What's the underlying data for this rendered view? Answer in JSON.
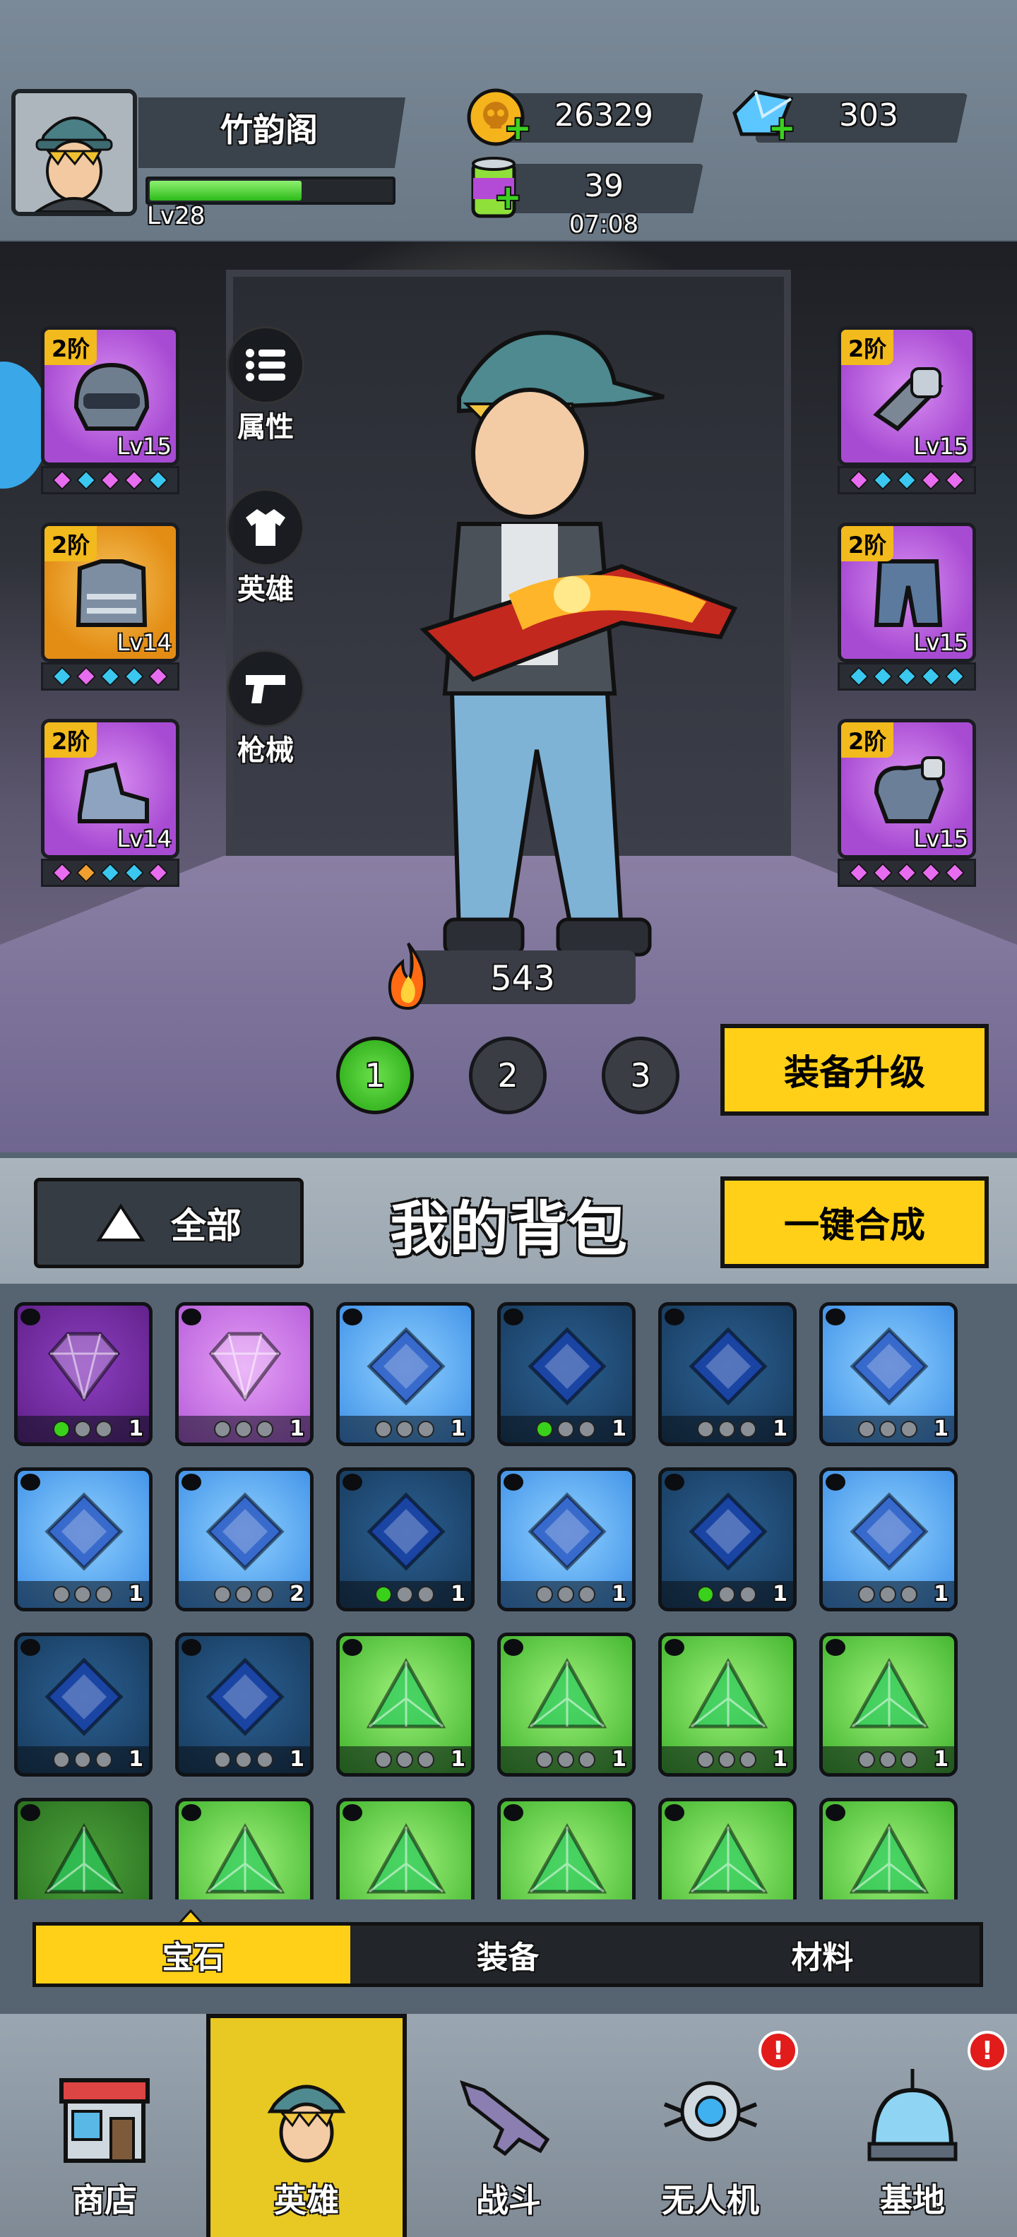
{
  "player": {
    "name": "竹韵阁",
    "level": "Lv28",
    "xp_fraction": 0.62
  },
  "resources": {
    "coins": "26329",
    "diamonds": "303",
    "energy": "39",
    "energy_timer": "07:08"
  },
  "equipment": {
    "left": [
      {
        "tier": "2阶",
        "level": "Lv15",
        "rarity": "purple",
        "icon": "helmet-icon"
      },
      {
        "tier": "2阶",
        "level": "Lv14",
        "rarity": "orange",
        "icon": "armor-icon"
      },
      {
        "tier": "2阶",
        "level": "Lv14",
        "rarity": "purple",
        "icon": "shoe-icon"
      }
    ],
    "right": [
      {
        "tier": "2阶",
        "level": "Lv15",
        "rarity": "purple",
        "icon": "bracer-icon"
      },
      {
        "tier": "2阶",
        "level": "Lv15",
        "rarity": "purple",
        "icon": "pants-icon"
      },
      {
        "tier": "2阶",
        "level": "Lv15",
        "rarity": "purple",
        "icon": "glove-icon"
      }
    ]
  },
  "side_menu": {
    "attributes": "属性",
    "hero": "英雄",
    "weapons": "枪械"
  },
  "combat_power": "543",
  "pages": [
    "1",
    "2",
    "3"
  ],
  "active_page": 0,
  "upgrade_button": "装备升级",
  "backpack": {
    "filter_label": "全部",
    "title": "我的背包",
    "merge_button": "一键合成",
    "tabs": [
      "宝石",
      "装备",
      "材料"
    ],
    "active_tab": 0,
    "items": [
      {
        "color": "purple-d",
        "shape": "diamond",
        "count": "1",
        "lit": 1
      },
      {
        "color": "purple-l",
        "shape": "diamond",
        "count": "1",
        "lit": 0
      },
      {
        "color": "blue-l",
        "shape": "square",
        "count": "1",
        "lit": 0
      },
      {
        "color": "blue-d",
        "shape": "square",
        "count": "1",
        "lit": 1
      },
      {
        "color": "blue-d",
        "shape": "square",
        "count": "1",
        "lit": 0
      },
      {
        "color": "blue-l",
        "shape": "square",
        "count": "1",
        "lit": 0
      },
      {
        "color": "blue-l",
        "shape": "square",
        "count": "1",
        "lit": 0
      },
      {
        "color": "blue-l",
        "shape": "square",
        "count": "2",
        "lit": 0
      },
      {
        "color": "blue-d",
        "shape": "square",
        "count": "1",
        "lit": 1
      },
      {
        "color": "blue-l",
        "shape": "square",
        "count": "1",
        "lit": 0
      },
      {
        "color": "blue-d",
        "shape": "square",
        "count": "1",
        "lit": 1
      },
      {
        "color": "blue-l",
        "shape": "square",
        "count": "1",
        "lit": 0
      },
      {
        "color": "blue-d",
        "shape": "square",
        "count": "1",
        "lit": 0
      },
      {
        "color": "blue-d",
        "shape": "square",
        "count": "1",
        "lit": 0
      },
      {
        "color": "green-l",
        "shape": "triangle",
        "count": "1",
        "lit": 0
      },
      {
        "color": "green-l",
        "shape": "triangle",
        "count": "1",
        "lit": 0
      },
      {
        "color": "green-l",
        "shape": "triangle",
        "count": "1",
        "lit": 0
      },
      {
        "color": "green-l",
        "shape": "triangle",
        "count": "1",
        "lit": 0
      },
      {
        "color": "green-d",
        "shape": "triangle",
        "count": "",
        "lit": 0
      },
      {
        "color": "green-l",
        "shape": "triangle",
        "count": "",
        "lit": 0
      },
      {
        "color": "green-l",
        "shape": "triangle",
        "count": "",
        "lit": 0
      },
      {
        "color": "green-l",
        "shape": "triangle",
        "count": "",
        "lit": 0
      },
      {
        "color": "green-l",
        "shape": "triangle",
        "count": "",
        "lit": 0
      },
      {
        "color": "green-l",
        "shape": "triangle",
        "count": "",
        "lit": 0
      }
    ]
  },
  "nav": [
    {
      "label": "商店",
      "icon": "shop-icon",
      "badge": ""
    },
    {
      "label": "英雄",
      "icon": "hero-icon",
      "badge": ""
    },
    {
      "label": "战斗",
      "icon": "rifle-icon",
      "badge": ""
    },
    {
      "label": "无人机",
      "icon": "drone-icon",
      "badge": "!"
    },
    {
      "label": "基地",
      "icon": "base-icon",
      "badge": "!"
    }
  ],
  "active_nav": 1,
  "colors": {
    "accent_yellow": "#ffd017",
    "xp_green": "#2cba18",
    "badge_red": "#e21b1b"
  }
}
